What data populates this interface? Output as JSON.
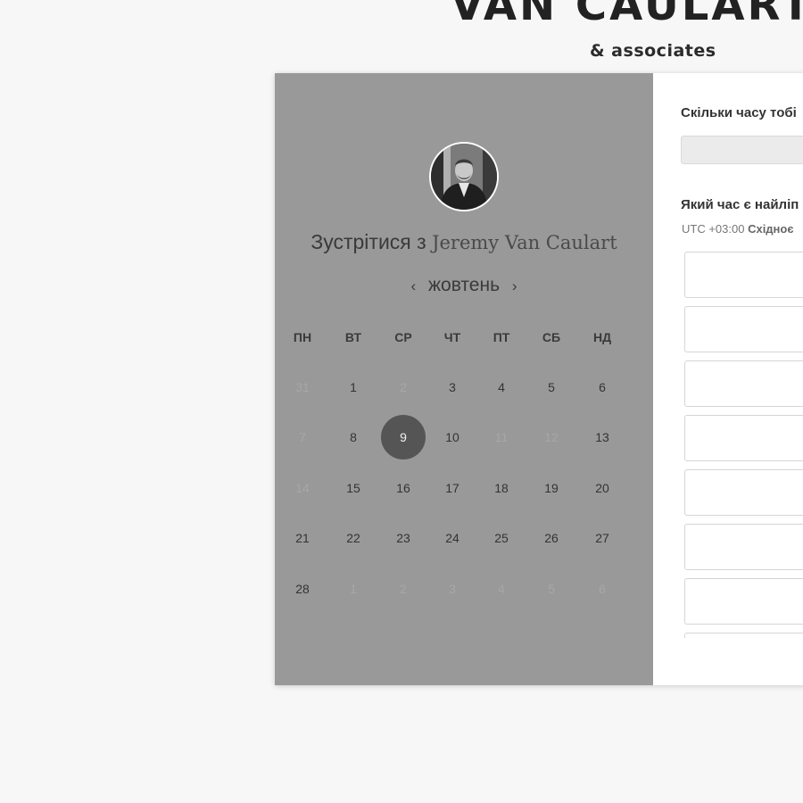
{
  "brand": {
    "title": "VAN CAULART",
    "subtitle": "& associates"
  },
  "left": {
    "meet_prefix": "Зустрітися з",
    "host_name": "Jeremy Van Caulart",
    "month": "жовтень",
    "prev_icon": "‹",
    "next_icon": "›",
    "weekdays": [
      "ПН",
      "ВТ",
      "СР",
      "ЧТ",
      "ПТ",
      "СБ",
      "НД"
    ],
    "weeks": [
      [
        {
          "d": "31",
          "muted": true
        },
        {
          "d": "1",
          "muted": false
        },
        {
          "d": "2",
          "muted": true
        },
        {
          "d": "3",
          "muted": false
        },
        {
          "d": "4",
          "muted": false
        },
        {
          "d": "5",
          "muted": false
        },
        {
          "d": "6",
          "muted": false
        }
      ],
      [
        {
          "d": "7",
          "muted": true
        },
        {
          "d": "8",
          "muted": false
        },
        {
          "d": "9",
          "muted": false,
          "selected": true
        },
        {
          "d": "10",
          "muted": false
        },
        {
          "d": "11",
          "muted": true
        },
        {
          "d": "12",
          "muted": true
        },
        {
          "d": "13",
          "muted": false
        }
      ],
      [
        {
          "d": "14",
          "muted": true
        },
        {
          "d": "15",
          "muted": false
        },
        {
          "d": "16",
          "muted": false
        },
        {
          "d": "17",
          "muted": false
        },
        {
          "d": "18",
          "muted": false
        },
        {
          "d": "19",
          "muted": false
        },
        {
          "d": "20",
          "muted": false
        }
      ],
      [
        {
          "d": "21",
          "muted": false
        },
        {
          "d": "22",
          "muted": false
        },
        {
          "d": "23",
          "muted": false
        },
        {
          "d": "24",
          "muted": false
        },
        {
          "d": "25",
          "muted": false
        },
        {
          "d": "26",
          "muted": false
        },
        {
          "d": "27",
          "muted": false
        }
      ],
      [
        {
          "d": "28",
          "muted": false
        },
        {
          "d": "1",
          "muted": true
        },
        {
          "d": "2",
          "muted": true
        },
        {
          "d": "3",
          "muted": true
        },
        {
          "d": "4",
          "muted": true
        },
        {
          "d": "5",
          "muted": true
        },
        {
          "d": "6",
          "muted": true
        }
      ]
    ]
  },
  "right": {
    "duration_question": "Скільки часу тобі",
    "time_question": "Який час є найліп",
    "timezone_offset": "UTC +03:00",
    "timezone_name": "Східноє",
    "slot_count": 8
  },
  "colors": {
    "left_panel_bg": "#999999",
    "selected_day_bg": "#555555",
    "page_bg": "#f7f7f7"
  }
}
